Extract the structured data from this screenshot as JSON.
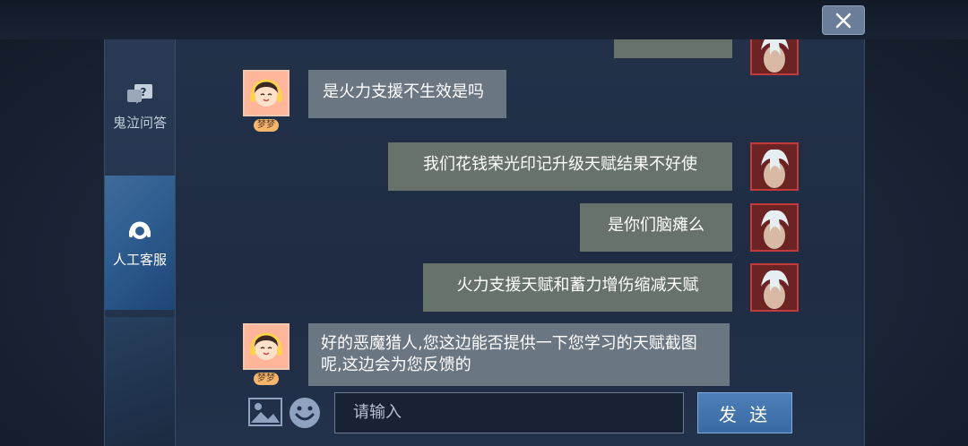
{
  "window": {
    "close_icon": "close-icon"
  },
  "sidebar": {
    "items": [
      {
        "label": "鬼泣问答",
        "icon": "question-chat-icon"
      },
      {
        "label": "人工客服",
        "icon": "headset-icon"
      }
    ]
  },
  "chat": {
    "agent_name": "梦梦",
    "messages": [
      {
        "side": "right",
        "text": ""
      },
      {
        "side": "left",
        "text": "是火力支援不生效是吗"
      },
      {
        "side": "right",
        "text": "我们花钱荣光印记升级天赋结果不好使"
      },
      {
        "side": "right",
        "text": "是你们脑瘫么"
      },
      {
        "side": "right",
        "text": "火力支援天赋和蓄力增伤缩减天赋"
      },
      {
        "side": "left",
        "text": "好的恶魔猎人,您这边能否提供一下您学习的天赋截图呢,这边会为您反馈的"
      }
    ]
  },
  "input": {
    "placeholder": "请输入",
    "send_label": "发 送",
    "image_icon": "image-icon",
    "emoji_icon": "emoji-icon"
  },
  "colors": {
    "agent_bubble": "#6b7683",
    "user_bubble": "#67736a",
    "active_tab": "#2f5e91",
    "send_button": "#3a6aa3"
  }
}
